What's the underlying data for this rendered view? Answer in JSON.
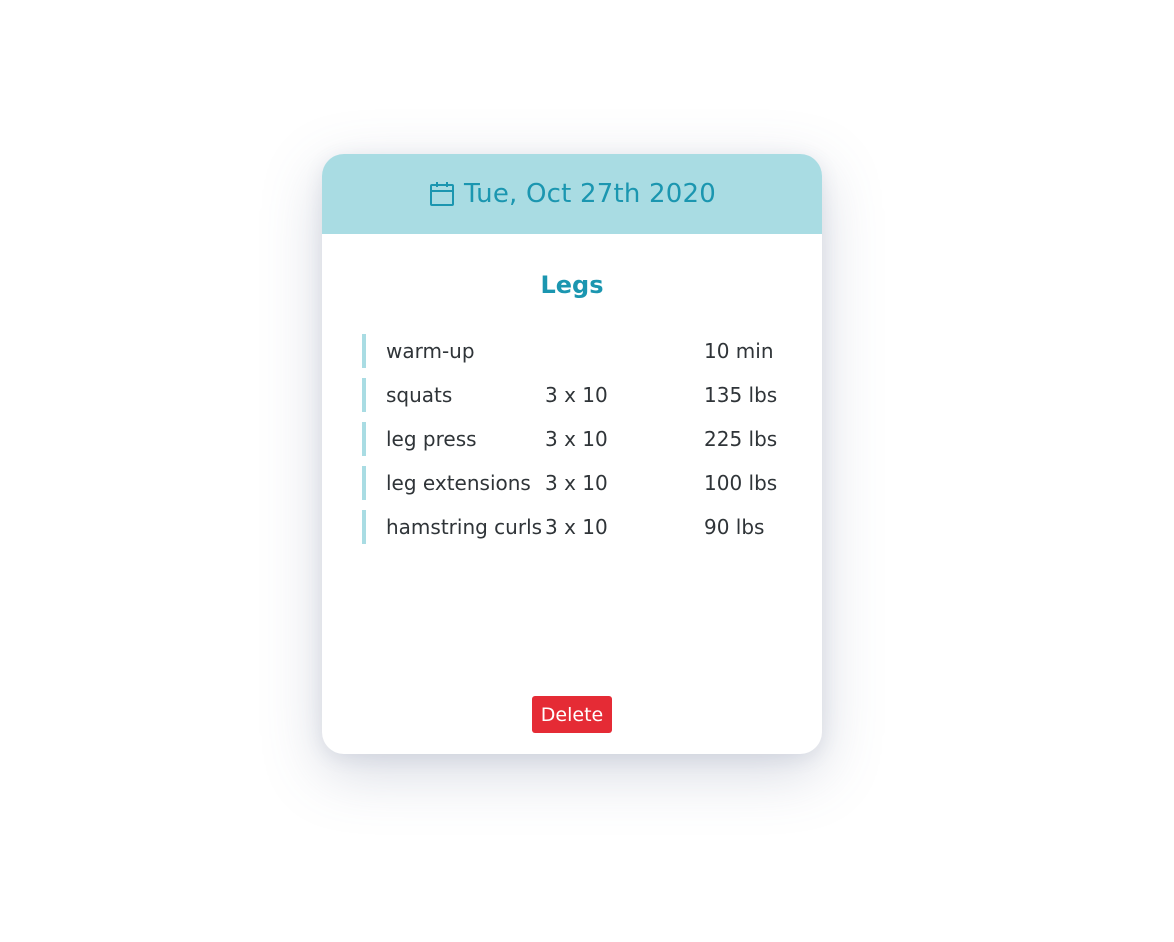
{
  "card": {
    "date": "Tue, Oct 27th 2020",
    "date_icon": "calendar-icon",
    "workout_title": "Legs",
    "exercises": [
      {
        "name": "warm-up",
        "sets": "",
        "amount": "10 min"
      },
      {
        "name": "squats",
        "sets": "3 x 10",
        "amount": "135 lbs"
      },
      {
        "name": "leg press",
        "sets": "3 x 10",
        "amount": "225 lbs"
      },
      {
        "name": "leg extensions",
        "sets": "3 x 10",
        "amount": "100 lbs"
      },
      {
        "name": "hamstring curls",
        "sets": "3 x 10",
        "amount": "90 lbs"
      }
    ],
    "delete_label": "Delete"
  },
  "colors": {
    "header_bg": "#a9dce3",
    "accent": "#1b96b0",
    "danger": "#e52b35",
    "text": "#2f3438"
  }
}
